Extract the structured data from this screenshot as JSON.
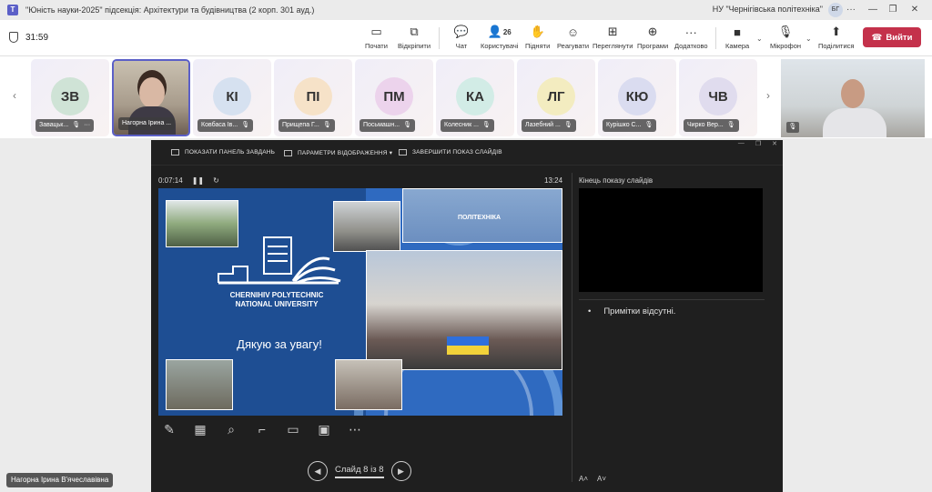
{
  "window": {
    "title": "\"Юність науки-2025\" підсекція: Архітектури та будівництва (2 корп. 301 ауд.)",
    "org": "НУ \"Чернігівська політехніка\"",
    "user_initials": "БГ"
  },
  "toolbar": {
    "timer": "31:59",
    "share_label": "Почати",
    "popout_label": "Відкріпити",
    "chat_label": "Чат",
    "people_label": "Користувачі",
    "people_count": "26",
    "raise_label": "Підняти",
    "react_label": "Реагувати",
    "view_label": "Переглянути",
    "apps_label": "Програми",
    "more_label": "Додатково",
    "camera_label": "Камера",
    "mic_label": "Мікрофон",
    "share_screen_label": "Поділитися",
    "leave_label": "Вийти"
  },
  "participants": [
    {
      "initials": "ЗВ",
      "name": "Завацьк...",
      "color": "#cfe3d6"
    },
    {
      "initials": "",
      "name": "Нагорна Ірина ...",
      "color": "#d8d2c8"
    },
    {
      "initials": "КІ",
      "name": "Ковбаса Ів...",
      "color": "#d6e1f0"
    },
    {
      "initials": "ПІ",
      "name": "Прищепа Г...",
      "color": "#f6e2c8"
    },
    {
      "initials": "ПМ",
      "name": "Посьмашн...",
      "color": "#ecd3ec"
    },
    {
      "initials": "КА",
      "name": "Колесник ...",
      "color": "#d2ece6"
    },
    {
      "initials": "ЛГ",
      "name": "Лазебний ...",
      "color": "#f3ecc0"
    },
    {
      "initials": "КЮ",
      "name": "Курішко С...",
      "color": "#dadcf0"
    },
    {
      "initials": "ЧВ",
      "name": "Чирко Вер...",
      "color": "#e0dcee"
    }
  ],
  "presenter": {
    "show_taskbar": "ПОКАЗАТИ ПАНЕЛЬ ЗАВДАНЬ",
    "display_settings": "ПАРАМЕТРИ ВІДОБРАЖЕННЯ ▾",
    "end_show": "ЗАВЕРШИТИ ПОКАЗ СЛАЙДІВ",
    "elapsed": "0:07:14",
    "clock": "13:24",
    "slide_counter": "Слайд 8 із 8",
    "next_label": "Кінець показу слайдів",
    "notes": "Примітки відсутні.",
    "slide_uni_line1": "CHERNIHIV POLYTECHNIC",
    "slide_uni_line2": "NATIONAL UNIVERSITY",
    "slide_thanks": "Дякую за увагу!",
    "slide_building_text": "ПОЛІТЕХНІКА"
  },
  "presenter_name": "Нагорна Ірина В'ячеславівна"
}
